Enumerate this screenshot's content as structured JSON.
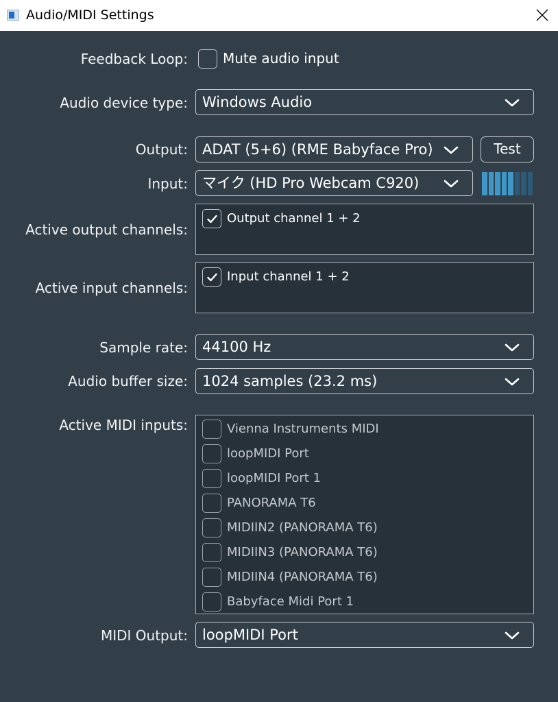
{
  "window": {
    "title": "Audio/MIDI Settings"
  },
  "feedback_loop": {
    "label": "Feedback Loop:",
    "checkbox_label": "Mute audio input",
    "checked": false
  },
  "audio_device_type": {
    "label": "Audio device type:",
    "value": "Windows Audio"
  },
  "output": {
    "label": "Output:",
    "value": "ADAT (5+6) (RME Babyface Pro)",
    "test_button": "Test"
  },
  "input": {
    "label": "Input:",
    "value": "マイク (HD Pro Webcam C920)",
    "level_meter": {
      "segments": 8,
      "lit_segments": 5,
      "lit_color": "#3f97c9",
      "dim_color": "#2c5a78"
    }
  },
  "active_output_channels": {
    "label": "Active output channels:",
    "items": [
      {
        "label": "Output channel 1 + 2",
        "checked": true
      }
    ]
  },
  "active_input_channels": {
    "label": "Active input channels:",
    "items": [
      {
        "label": "Input channel 1 + 2",
        "checked": true
      }
    ]
  },
  "sample_rate": {
    "label": "Sample rate:",
    "value": "44100 Hz"
  },
  "audio_buffer_size": {
    "label": "Audio buffer size:",
    "value": "1024 samples (23.2 ms)"
  },
  "midi_inputs": {
    "label": "Active MIDI inputs:",
    "items": [
      {
        "label": "Vienna Instruments MIDI",
        "checked": false
      },
      {
        "label": "loopMIDI Port",
        "checked": false
      },
      {
        "label": "loopMIDI Port 1",
        "checked": false
      },
      {
        "label": "PANORAMA T6",
        "checked": false
      },
      {
        "label": "MIDIIN2 (PANORAMA T6)",
        "checked": false
      },
      {
        "label": "MIDIIN3 (PANORAMA T6)",
        "checked": false
      },
      {
        "label": "MIDIIN4 (PANORAMA T6)",
        "checked": false
      },
      {
        "label": "Babyface Midi Port 1",
        "checked": false
      }
    ]
  },
  "midi_output": {
    "label": "MIDI Output:",
    "value": "loopMIDI Port"
  },
  "colors": {
    "background": "#323e48",
    "listbox_background": "#27313a",
    "border": "#c9cdd1",
    "text": "#ffffff"
  }
}
